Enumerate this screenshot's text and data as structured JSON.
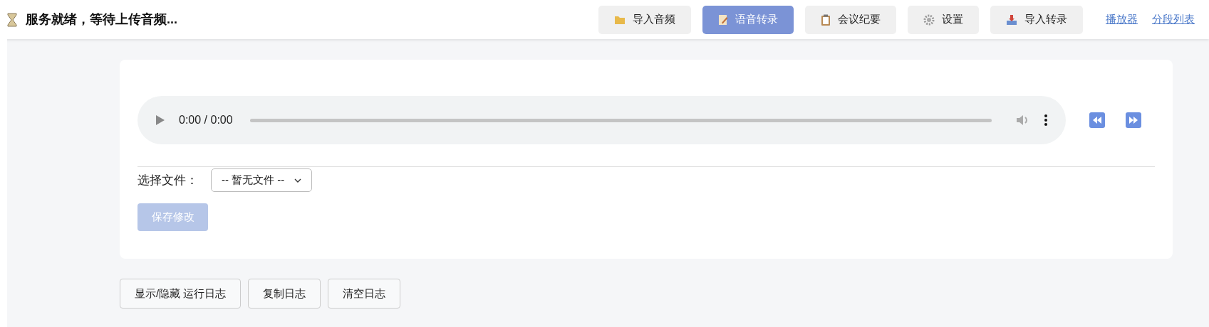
{
  "header": {
    "status": "服务就绪，等待上传音频...",
    "nav": [
      {
        "label": "导入音频",
        "kind": "folder",
        "selected": false
      },
      {
        "label": "语音转录",
        "kind": "memo",
        "selected": true
      },
      {
        "label": "会议纪要",
        "kind": "clipboard",
        "selected": false
      },
      {
        "label": "设置",
        "kind": "gear",
        "selected": false
      },
      {
        "label": "导入转录",
        "kind": "inbox",
        "selected": false
      }
    ],
    "links": [
      "播放器",
      "分段列表"
    ]
  },
  "player": {
    "time": "0:00 / 0:00"
  },
  "file_select": {
    "label": "选择文件：",
    "value": "-- 暂无文件 --"
  },
  "save_button": {
    "label": "保存修改",
    "disabled": true
  },
  "log_buttons": [
    "显示/隐藏 运行日志",
    "复制日志",
    "清空日志"
  ]
}
